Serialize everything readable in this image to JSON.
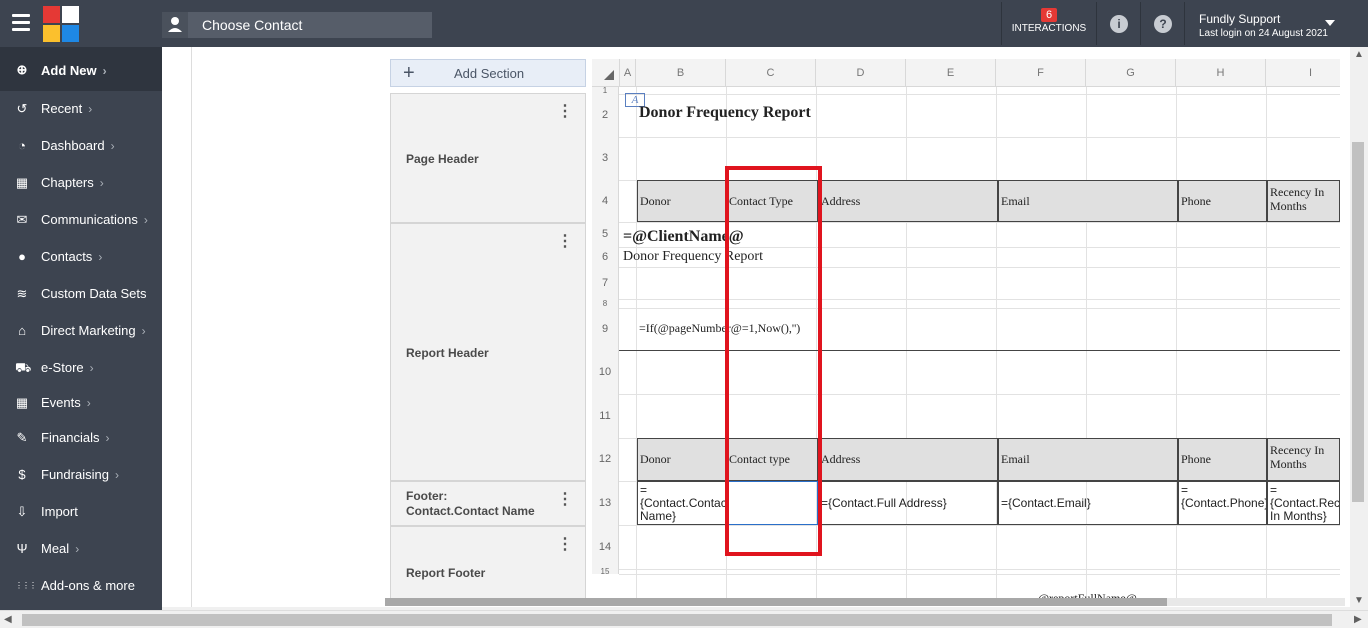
{
  "topbar": {
    "contact_placeholder": "Choose Contact",
    "interactions_count": "6",
    "interactions_label": "INTERACTIONS",
    "user_name": "Fundly Support",
    "last_login": "Last login on 24 August 2021",
    "info_icon": "i",
    "help_icon": "?"
  },
  "sidebar": {
    "add_new": "Add New",
    "items": [
      {
        "label": "Recent",
        "icon": "↺",
        "chev": "›"
      },
      {
        "label": "Dashboard",
        "icon": "◔",
        "chev": "›"
      },
      {
        "label": "Chapters",
        "icon": "▦",
        "chev": "›"
      },
      {
        "label": "Communications",
        "icon": "✉",
        "chev": "›"
      },
      {
        "label": "Contacts",
        "icon": "●",
        "chev": "›"
      },
      {
        "label": "Custom Data Sets",
        "icon": "≋",
        "chev": ""
      },
      {
        "label": "Direct Marketing",
        "icon": "⌂",
        "chev": "›"
      },
      {
        "label": "e-Store",
        "icon": "⛟",
        "chev": "›"
      },
      {
        "label": "Events",
        "icon": "▦",
        "chev": "›"
      },
      {
        "label": "Financials",
        "icon": "✎",
        "chev": "›"
      },
      {
        "label": "Fundraising",
        "icon": "$",
        "chev": "›"
      },
      {
        "label": "Import",
        "icon": "⇩",
        "chev": ""
      },
      {
        "label": "Meal",
        "icon": "Ψ",
        "chev": "›"
      },
      {
        "label": "Add-ons & more",
        "icon": "⋮⋮⋮",
        "chev": ""
      }
    ]
  },
  "designer": {
    "add_section": "Add Section",
    "sections": {
      "page_header": "Page Header",
      "report_header": "Report Header",
      "footer_line1": "Footer:",
      "footer_line2": "Contact.Contact Name",
      "report_footer": "Report Footer"
    },
    "columns": [
      "A",
      "B",
      "C",
      "D",
      "E",
      "F",
      "G",
      "H",
      "I"
    ],
    "rows": [
      "1",
      "2",
      "3",
      "4",
      "5",
      "6",
      "7",
      "8",
      "9",
      "10",
      "11",
      "12",
      "13",
      "14",
      "15"
    ],
    "title": "Donor Frequency Report",
    "page_header_cols": [
      "Donor",
      "Contact Type",
      "Address",
      "Email",
      "Phone",
      "Recency In Months"
    ],
    "client_name": "=@ClientName@",
    "subtitle": "Donor Frequency Report",
    "formula": "=If(@pageNumber@=1,Now(),'')",
    "detail_header_cols": [
      "Donor",
      "Contact type",
      "Address",
      "Email",
      "Phone",
      "Recency In Months"
    ],
    "detail_values": [
      "={Contact.Contact Name}",
      "",
      "={Contact.Full Address}",
      "={Contact.Email}",
      "={Contact.Phone}",
      "={Contact.Recency In Months}"
    ],
    "report_full_name": "@reportFullName@"
  }
}
